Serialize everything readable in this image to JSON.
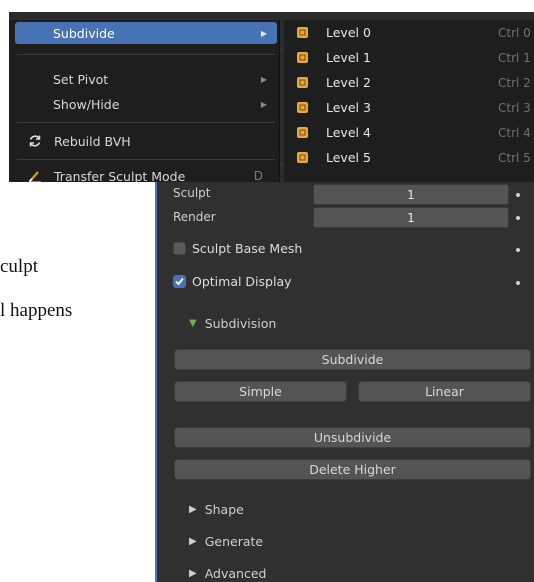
{
  "document": {
    "line1": "culpt",
    "line2": "l happens"
  },
  "menu": {
    "items": [
      {
        "label": "Subdivide",
        "has_submenu": true,
        "active": true
      },
      {
        "label": "Set Pivot",
        "has_submenu": true
      },
      {
        "label": "Show/Hide",
        "has_submenu": true
      },
      {
        "label": "Rebuild BVH",
        "icon": "refresh-icon"
      },
      {
        "label": "Transfer Sculpt Mode",
        "icon": "brush-icon",
        "shortcut": "D"
      }
    ],
    "submenu": [
      {
        "label": "Level 0",
        "shortcut": "Ctrl 0",
        "icon": "modifier-icon"
      },
      {
        "label": "Level 1",
        "shortcut": "Ctrl 1",
        "icon": "modifier-icon"
      },
      {
        "label": "Level 2",
        "shortcut": "Ctrl 2",
        "icon": "modifier-icon"
      },
      {
        "label": "Level 3",
        "shortcut": "Ctrl 3",
        "icon": "modifier-icon"
      },
      {
        "label": "Level 4",
        "shortcut": "Ctrl 4",
        "icon": "modifier-icon"
      },
      {
        "label": "Level 5",
        "shortcut": "Ctrl 5",
        "icon": "modifier-icon"
      }
    ]
  },
  "panel": {
    "sculpt_label": "Sculpt",
    "sculpt_value": "1",
    "render_label": "Render",
    "render_value": "1",
    "sculpt_base_mesh": {
      "label": "Sculpt Base Mesh",
      "checked": false
    },
    "optimal_display": {
      "label": "Optimal Display",
      "checked": true
    },
    "subdivision_header": "Subdivision",
    "buttons": {
      "subdivide": "Subdivide",
      "simple": "Simple",
      "linear": "Linear",
      "unsubdivide": "Unsubdivide",
      "delete_higher": "Delete Higher"
    },
    "sections": {
      "shape": "Shape",
      "generate": "Generate",
      "advanced": "Advanced"
    }
  },
  "colors": {
    "accent": "#4772b3",
    "panel_bg": "#303030",
    "menu_bg": "#1e1e1e",
    "expand_arrow": "#6fb04a",
    "modifier_icon": "#e7a93a"
  }
}
